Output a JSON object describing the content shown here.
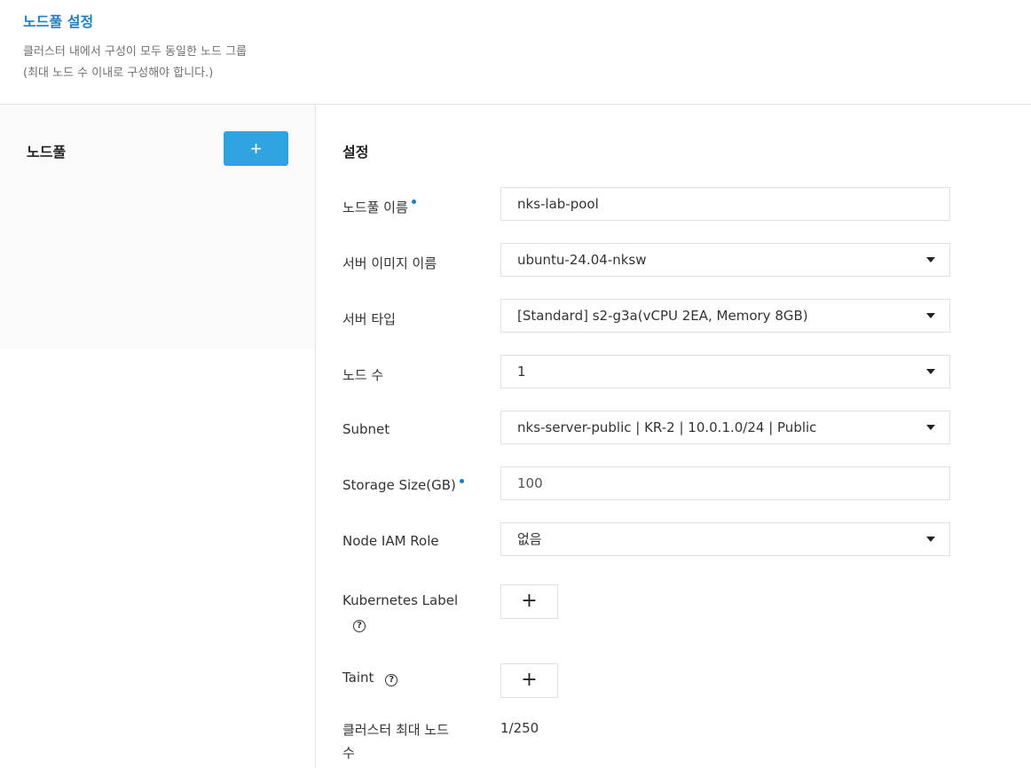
{
  "header": {
    "title": "노드풀 설정",
    "desc_line1": "클러스터 내에서 구성이 모두 동일한 노드 그룹",
    "desc_line2": "(최대 노드 수 이내로 구성해야 합니다.)"
  },
  "left_panel": {
    "label": "노드풀",
    "add_button": "+"
  },
  "settings": {
    "title": "설정",
    "nodepool_name": {
      "label": "노드풀 이름",
      "value": "nks-lab-pool"
    },
    "server_image": {
      "label": "서버 이미지 이름",
      "value": "ubuntu-24.04-nksw"
    },
    "server_type": {
      "label": "서버 타입",
      "value": "[Standard] s2-g3a(vCPU 2EA, Memory 8GB)"
    },
    "node_count": {
      "label": "노드 수",
      "value": "1"
    },
    "subnet": {
      "label": "Subnet",
      "value": "nks-server-public | KR-2 | 10.0.1.0/24 | Public"
    },
    "storage_size": {
      "label": "Storage Size(GB)",
      "value": "100"
    },
    "node_iam_role": {
      "label": "Node IAM Role",
      "value": "없음"
    },
    "kubernetes_label": {
      "label": "Kubernetes Label",
      "add": "+"
    },
    "taint": {
      "label": "Taint",
      "add": "+"
    },
    "cluster_max_nodes": {
      "label_line1": "클러스터 최대 노드",
      "label_line2": "수",
      "value": "1/250"
    }
  },
  "icons": {
    "help": "?",
    "caret": "chevron-down-icon"
  },
  "colors": {
    "accent": "#2ea3de",
    "title_blue": "#1f7fc4"
  }
}
